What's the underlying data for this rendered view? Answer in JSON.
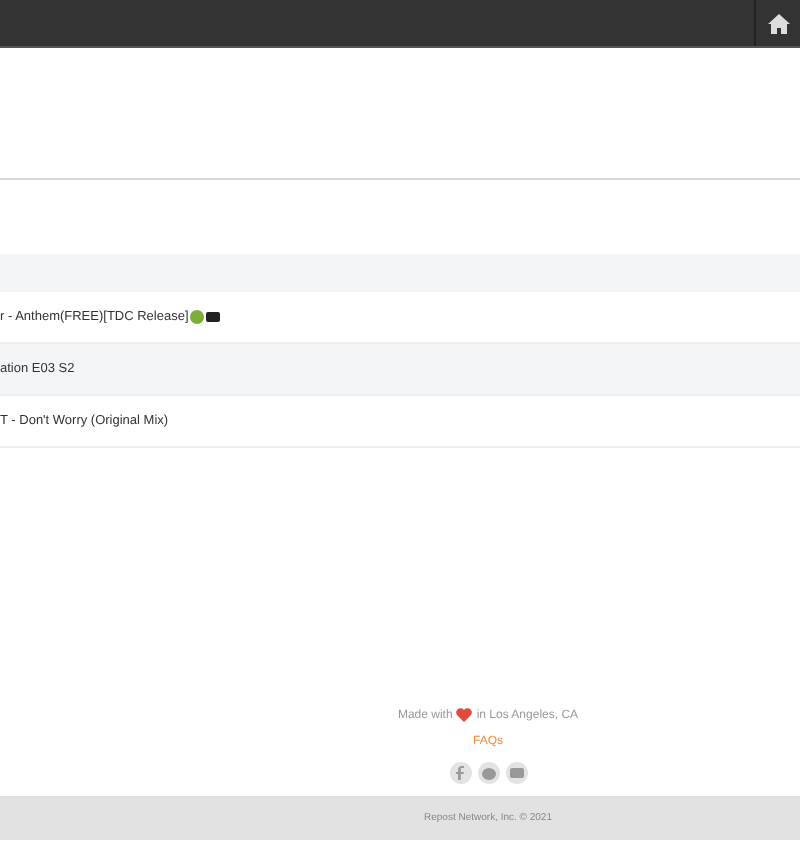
{
  "tracks": [
    {
      "title": "r - Anthem(FREE)[TDC Release]",
      "selected": false,
      "badges": true
    },
    {
      "title": "ation E03 S2",
      "selected": true,
      "badges": false
    },
    {
      "title": "T - Don't Worry (Original Mix)",
      "selected": false,
      "badges": false
    }
  ],
  "footer": {
    "made_with": "Made with",
    "location": "in Los Angeles, CA",
    "faqs": "FAQs",
    "copyright": "Repost Network, Inc. © 2021"
  }
}
